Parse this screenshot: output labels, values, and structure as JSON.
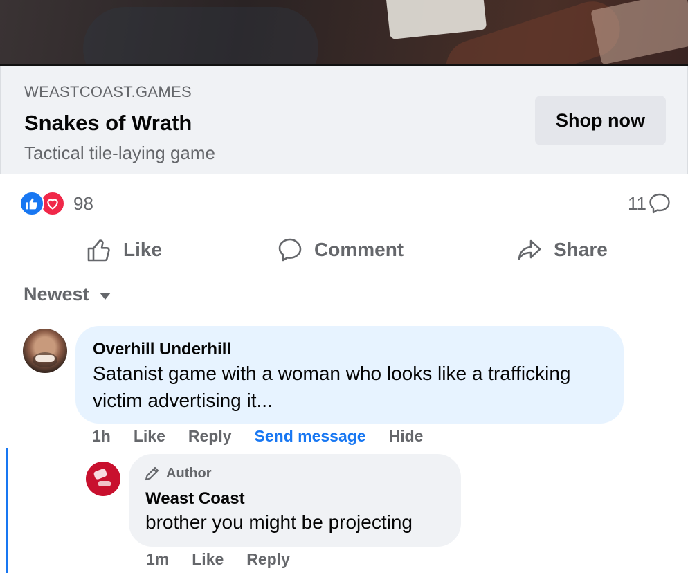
{
  "ad": {
    "domain": "WEASTCOAST.GAMES",
    "title": "Snakes of Wrath",
    "description": "Tactical tile-laying game",
    "cta_label": "Shop now"
  },
  "stats": {
    "reaction_count": "98",
    "comment_count": "11",
    "reaction_icons": [
      "like-icon",
      "love-icon"
    ]
  },
  "actions": {
    "like": "Like",
    "comment": "Comment",
    "share": "Share"
  },
  "sort": {
    "label": "Newest"
  },
  "comments": [
    {
      "author": "Overhill Underhill",
      "text": "Satanist game with a woman who looks like a trafficking victim advertising it...",
      "time": "1h",
      "like": "Like",
      "reply": "Reply",
      "send_message": "Send message",
      "hide": "Hide"
    }
  ],
  "reply": {
    "badge": "Author",
    "author": "Weast Coast",
    "text": "brother you might be projecting",
    "time": "1m",
    "like": "Like",
    "reply": "Reply"
  },
  "colors": {
    "accent": "#1877f2",
    "love": "#f02849",
    "muted_text": "#65676b",
    "bubble_highlight": "#e7f3ff",
    "bubble_default": "#f0f2f5"
  }
}
